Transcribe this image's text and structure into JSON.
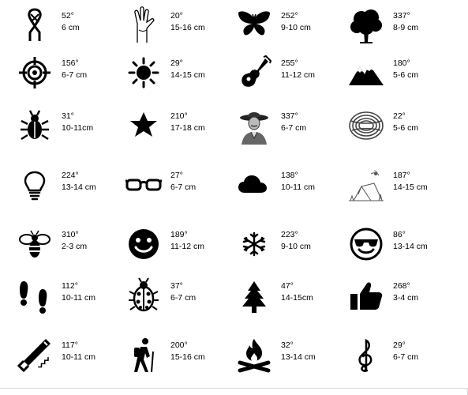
{
  "items": [
    {
      "icon": "knot-icon",
      "angle": "52°",
      "size": "6 cm"
    },
    {
      "icon": "scout-salute-icon",
      "angle": "20°",
      "size": "15-16 cm"
    },
    {
      "icon": "butterfly-icon",
      "angle": "252°",
      "size": "9-10 cm"
    },
    {
      "icon": "tree-icon",
      "angle": "337°",
      "size": "8-9 cm"
    },
    {
      "icon": "target-icon",
      "angle": "156°",
      "size": "6-7 cm"
    },
    {
      "icon": "sun-icon",
      "angle": "29°",
      "size": "14-15 cm"
    },
    {
      "icon": "guitar-icon",
      "angle": "255°",
      "size": "11-12 cm"
    },
    {
      "icon": "mountains-icon",
      "angle": "180°",
      "size": "5-6 cm"
    },
    {
      "icon": "bug-icon",
      "angle": "31°",
      "size": "10-11cm"
    },
    {
      "icon": "star-icon",
      "angle": "210°",
      "size": "17-18 cm"
    },
    {
      "icon": "scout-founder-portrait-icon",
      "angle": "337°",
      "size": "6-7 cm"
    },
    {
      "icon": "rope-coil-icon",
      "angle": "22°",
      "size": "5-6 cm"
    },
    {
      "icon": "lightbulb-icon",
      "angle": "224°",
      "size": "13-14 cm"
    },
    {
      "icon": "glasses-icon",
      "angle": "27°",
      "size": "6-7 cm"
    },
    {
      "icon": "cloud-icon",
      "angle": "138°",
      "size": "10-11 cm"
    },
    {
      "icon": "campsite-tent-icon",
      "angle": "187°",
      "size": "14-15 cm"
    },
    {
      "icon": "bee-icon",
      "angle": "310°",
      "size": "2-3 cm"
    },
    {
      "icon": "smiley-face-icon",
      "angle": "189°",
      "size": "11-12 cm"
    },
    {
      "icon": "snowflake-icon",
      "angle": "223°",
      "size": "9-10 cm"
    },
    {
      "icon": "sunglasses-smiley-icon",
      "angle": "86°",
      "size": "13-14 cm"
    },
    {
      "icon": "footprints-icon",
      "angle": "112°",
      "size": "10-11 cm"
    },
    {
      "icon": "ladybug-icon",
      "angle": "37°",
      "size": "6-7 cm"
    },
    {
      "icon": "pine-tree-icon",
      "angle": "47°",
      "size": "14-15cm"
    },
    {
      "icon": "thumbs-up-icon",
      "angle": "268°",
      "size": "3-4 cm"
    },
    {
      "icon": "saw-icon",
      "angle": "117°",
      "size": "10-11 cm"
    },
    {
      "icon": "hiker-icon",
      "angle": "200°",
      "size": "15-16 cm"
    },
    {
      "icon": "campfire-icon",
      "angle": "32°",
      "size": "13-14 cm"
    },
    {
      "icon": "treble-clef-icon",
      "angle": "29°",
      "size": "6-7 cm"
    }
  ]
}
